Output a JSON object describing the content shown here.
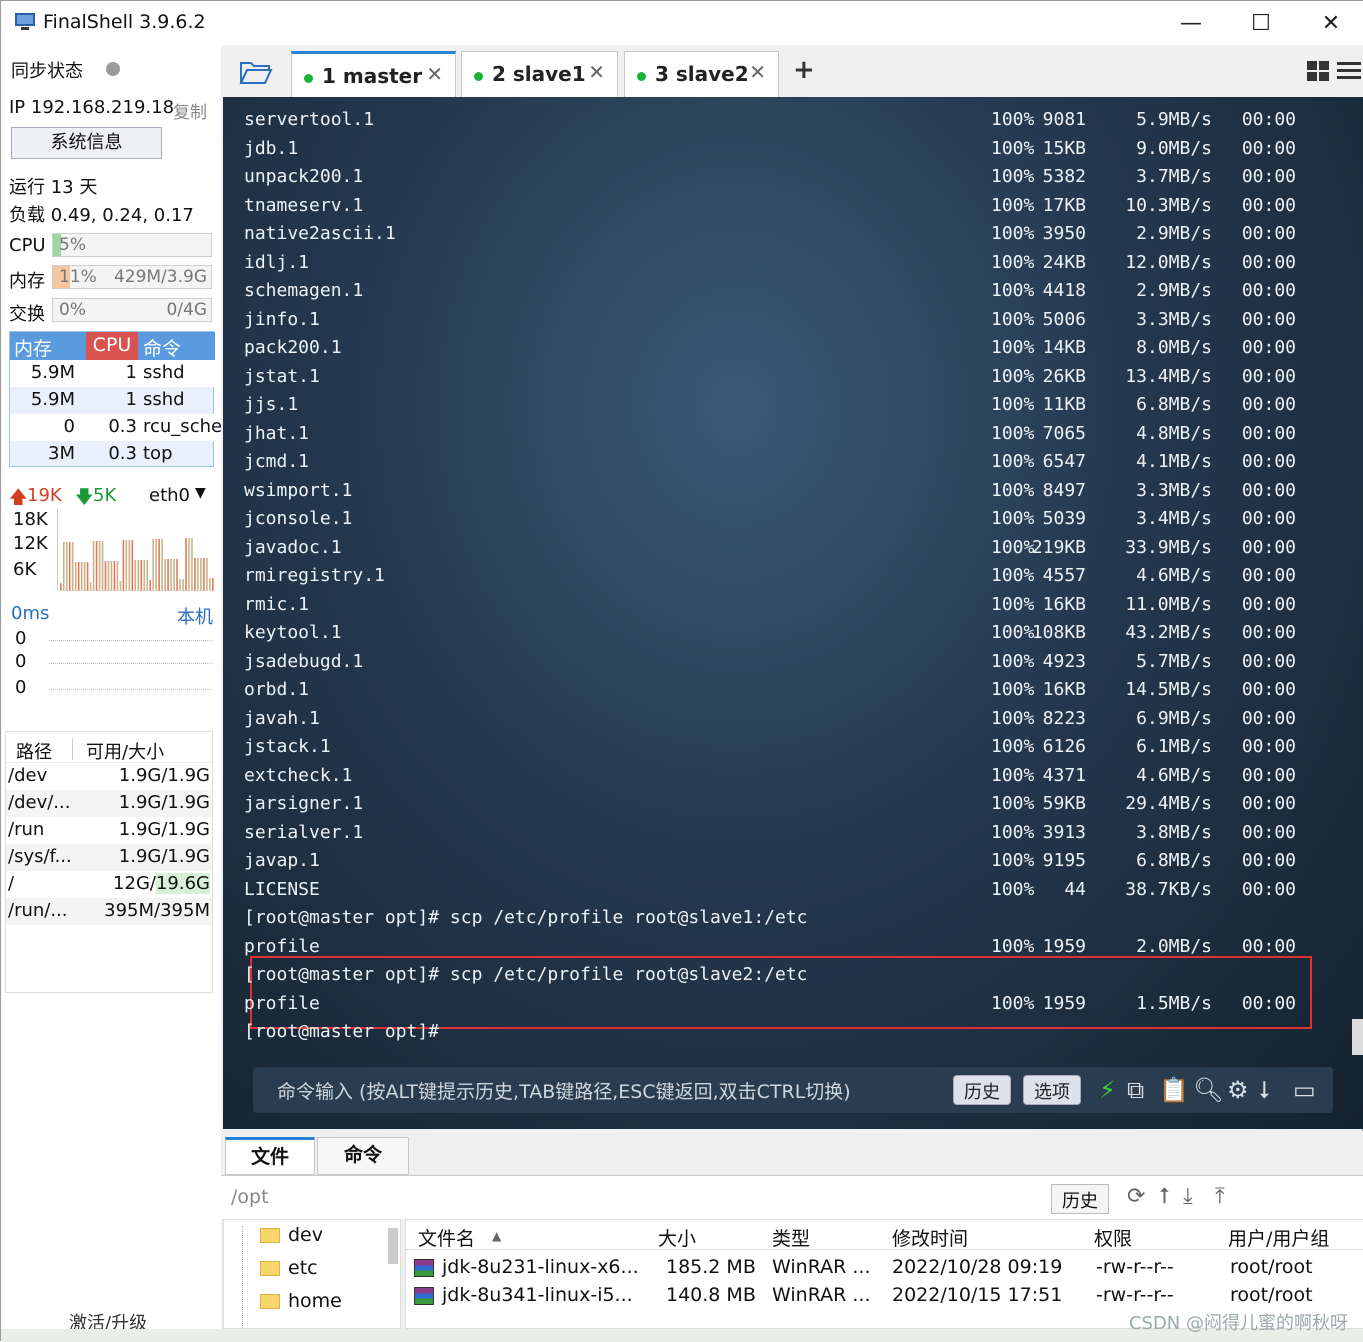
{
  "window": {
    "title": "FinalShell 3.9.6.2",
    "minimize": "—",
    "maximize": "☐",
    "close": "✕"
  },
  "sidebar": {
    "sync_label": "同步状态",
    "ip": "IP 192.168.219.18",
    "copy": "复制",
    "sysinfo_button": "系统信息",
    "uptime": "运行 13 天",
    "load": "负载 0.49, 0.24, 0.17",
    "cpu": {
      "label": "CPU",
      "value": "5%",
      "fraction": 0.05
    },
    "mem": {
      "label": "内存",
      "value": "11%",
      "detail": "429M/3.9G",
      "fraction": 0.11
    },
    "swap": {
      "label": "交换",
      "value": "0%",
      "detail": "0/4G",
      "fraction": 0.0
    },
    "proc_headers": [
      "内存",
      "CPU",
      "命令"
    ],
    "procs": [
      {
        "mem": "5.9M",
        "cpu": "1",
        "cmd": "sshd"
      },
      {
        "mem": "5.9M",
        "cpu": "1",
        "cmd": "sshd"
      },
      {
        "mem": "0",
        "cpu": "0.3",
        "cmd": "rcu_sche"
      },
      {
        "mem": "3M",
        "cpu": "0.3",
        "cmd": "top"
      }
    ],
    "net": {
      "up": "19K",
      "down": "5K",
      "iface": "eth0",
      "ticks": [
        "18K",
        "12K",
        "6K"
      ]
    },
    "ping": {
      "ms": "0ms",
      "host": "本机",
      "ticks": [
        "0",
        "0",
        "0"
      ]
    },
    "disk_headers": [
      "路径",
      "可用/大小"
    ],
    "disks": [
      {
        "path": "/dev",
        "size": "1.9G/1.9G"
      },
      {
        "path": "/dev/...",
        "size": "1.9G/1.9G"
      },
      {
        "path": "/run",
        "size": "1.9G/1.9G"
      },
      {
        "path": "/sys/f...",
        "size": "1.9G/1.9G"
      },
      {
        "path": "/",
        "size": "12G/19.6G"
      },
      {
        "path": "/run/...",
        "size": "395M/395M"
      }
    ],
    "activate": "激活/升级"
  },
  "tabs": [
    {
      "label": "1 master",
      "active": true
    },
    {
      "label": "2 slave1",
      "active": false
    },
    {
      "label": "3 slave2",
      "active": false
    }
  ],
  "tab_add": "+",
  "terminal": {
    "transfers": [
      {
        "name": "servertool.1",
        "pct": "100%",
        "size": "9081",
        "speed": "5.9MB/s",
        "time": "00:00"
      },
      {
        "name": "jdb.1",
        "pct": "100%",
        "size": "15KB",
        "speed": "9.0MB/s",
        "time": "00:00"
      },
      {
        "name": "unpack200.1",
        "pct": "100%",
        "size": "5382",
        "speed": "3.7MB/s",
        "time": "00:00"
      },
      {
        "name": "tnameserv.1",
        "pct": "100%",
        "size": "17KB",
        "speed": "10.3MB/s",
        "time": "00:00"
      },
      {
        "name": "native2ascii.1",
        "pct": "100%",
        "size": "3950",
        "speed": "2.9MB/s",
        "time": "00:00"
      },
      {
        "name": "idlj.1",
        "pct": "100%",
        "size": "24KB",
        "speed": "12.0MB/s",
        "time": "00:00"
      },
      {
        "name": "schemagen.1",
        "pct": "100%",
        "size": "4418",
        "speed": "2.9MB/s",
        "time": "00:00"
      },
      {
        "name": "jinfo.1",
        "pct": "100%",
        "size": "5006",
        "speed": "3.3MB/s",
        "time": "00:00"
      },
      {
        "name": "pack200.1",
        "pct": "100%",
        "size": "14KB",
        "speed": "8.0MB/s",
        "time": "00:00"
      },
      {
        "name": "jstat.1",
        "pct": "100%",
        "size": "26KB",
        "speed": "13.4MB/s",
        "time": "00:00"
      },
      {
        "name": "jjs.1",
        "pct": "100%",
        "size": "11KB",
        "speed": "6.8MB/s",
        "time": "00:00"
      },
      {
        "name": "jhat.1",
        "pct": "100%",
        "size": "7065",
        "speed": "4.8MB/s",
        "time": "00:00"
      },
      {
        "name": "jcmd.1",
        "pct": "100%",
        "size": "6547",
        "speed": "4.1MB/s",
        "time": "00:00"
      },
      {
        "name": "wsimport.1",
        "pct": "100%",
        "size": "8497",
        "speed": "3.3MB/s",
        "time": "00:00"
      },
      {
        "name": "jconsole.1",
        "pct": "100%",
        "size": "5039",
        "speed": "3.4MB/s",
        "time": "00:00"
      },
      {
        "name": "javadoc.1",
        "pct": "100%",
        "size": "219KB",
        "speed": "33.9MB/s",
        "time": "00:00"
      },
      {
        "name": "rmiregistry.1",
        "pct": "100%",
        "size": "4557",
        "speed": "4.6MB/s",
        "time": "00:00"
      },
      {
        "name": "rmic.1",
        "pct": "100%",
        "size": "16KB",
        "speed": "11.0MB/s",
        "time": "00:00"
      },
      {
        "name": "keytool.1",
        "pct": "100%",
        "size": "108KB",
        "speed": "43.2MB/s",
        "time": "00:00"
      },
      {
        "name": "jsadebugd.1",
        "pct": "100%",
        "size": "4923",
        "speed": "5.7MB/s",
        "time": "00:00"
      },
      {
        "name": "orbd.1",
        "pct": "100%",
        "size": "16KB",
        "speed": "14.5MB/s",
        "time": "00:00"
      },
      {
        "name": "javah.1",
        "pct": "100%",
        "size": "8223",
        "speed": "6.9MB/s",
        "time": "00:00"
      },
      {
        "name": "jstack.1",
        "pct": "100%",
        "size": "6126",
        "speed": "6.1MB/s",
        "time": "00:00"
      },
      {
        "name": "extcheck.1",
        "pct": "100%",
        "size": "4371",
        "speed": "4.6MB/s",
        "time": "00:00"
      },
      {
        "name": "jarsigner.1",
        "pct": "100%",
        "size": "59KB",
        "speed": "29.4MB/s",
        "time": "00:00"
      },
      {
        "name": "serialver.1",
        "pct": "100%",
        "size": "3913",
        "speed": "3.8MB/s",
        "time": "00:00"
      },
      {
        "name": "javap.1",
        "pct": "100%",
        "size": "9195",
        "speed": "6.8MB/s",
        "time": "00:00"
      },
      {
        "name": "LICENSE",
        "pct": "100%",
        "size": "44",
        "speed": "38.7KB/s",
        "time": "00:00"
      }
    ],
    "cmd1": "[root@master opt]# scp /etc/profile root@slave1:/etc",
    "profile1": {
      "name": "profile",
      "pct": "100%",
      "size": "1959",
      "speed": "2.0MB/s",
      "time": "00:00"
    },
    "cmd2": "[root@master opt]# scp /etc/profile root@slave2:/etc",
    "profile2": {
      "name": "profile",
      "pct": "100%",
      "size": "1959",
      "speed": "1.5MB/s",
      "time": "00:00"
    },
    "prompt": "[root@master opt]#",
    "input_placeholder": "命令输入 (按ALT键提示历史,TAB键路径,ESC键返回,双击CTRL切换)",
    "history_button": "历史",
    "options_button": "选项"
  },
  "bottom": {
    "tabs": [
      "文件",
      "命令"
    ],
    "path": "/opt",
    "history_button": "历史",
    "tree": [
      "dev",
      "etc",
      "home"
    ],
    "file_headers": [
      "文件名",
      "大小",
      "类型",
      "修改时间",
      "权限",
      "用户/用户组"
    ],
    "files": [
      {
        "name": "jdk-8u231-linux-x6...",
        "size": "185.2 MB",
        "type": "WinRAR ...",
        "mtime": "2022/10/28 09:19",
        "perm": "-rw-r--r--",
        "owner": "root/root"
      },
      {
        "name": "jdk-8u341-linux-i5...",
        "size": "140.8 MB",
        "type": "WinRAR ...",
        "mtime": "2022/10/15 17:51",
        "perm": "-rw-r--r--",
        "owner": "root/root"
      }
    ]
  },
  "watermark": "CSDN @闷得儿蜜的啊秋呀",
  "colors": {
    "accent": "#2b7fd4",
    "highlight_box": "#e03030",
    "net_up": "#d04020",
    "net_down": "#1a9a3a"
  }
}
